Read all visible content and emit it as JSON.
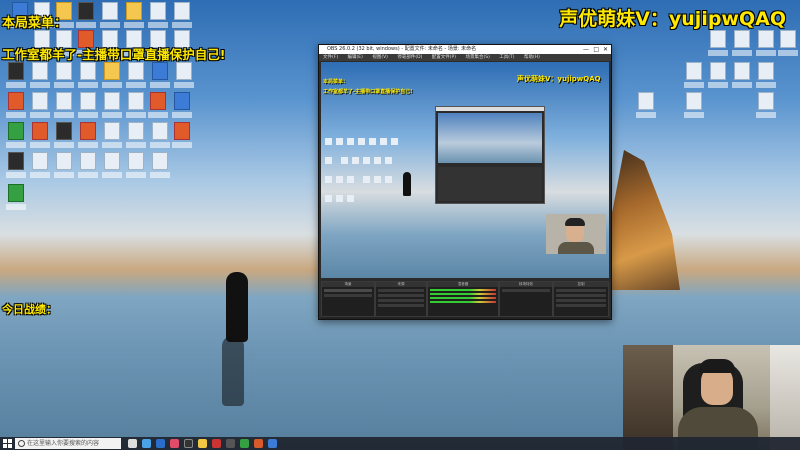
{
  "overlay": {
    "contact": "声优萌妹V：yujipwQAQ",
    "menu_title": "本局菜单：",
    "promo": "工作室都羊了-主播带口罩直播保护自己!",
    "today": "今日战绩："
  },
  "obs": {
    "title": "OBS 26.0.2 (32 bit, windows) - 配置文件: 未命名 - 场景: 未命名",
    "menu": [
      "文件(F)",
      "编辑(E)",
      "视图(V)",
      "停靠部件(D)",
      "配置文件(P)",
      "场景集合(S)",
      "工具(T)",
      "帮助(H)"
    ],
    "window_controls": [
      "—",
      "□",
      "✕"
    ],
    "preview_contact": "声优萌妹V：yujipwQAQ",
    "preview_menu_title": "本局菜单：",
    "preview_promo": "工作室都羊了-主播带口罩直播保护自己!",
    "docks": [
      "场景",
      "来源",
      "混音器",
      "转场特效",
      "控制"
    ]
  },
  "taskbar": {
    "search_placeholder": "在这里输入你要搜索的内容"
  },
  "colors": {
    "overlay_text": "#ffe900",
    "obs_bg": "#2b2b2b",
    "taskbar": "#202630"
  }
}
